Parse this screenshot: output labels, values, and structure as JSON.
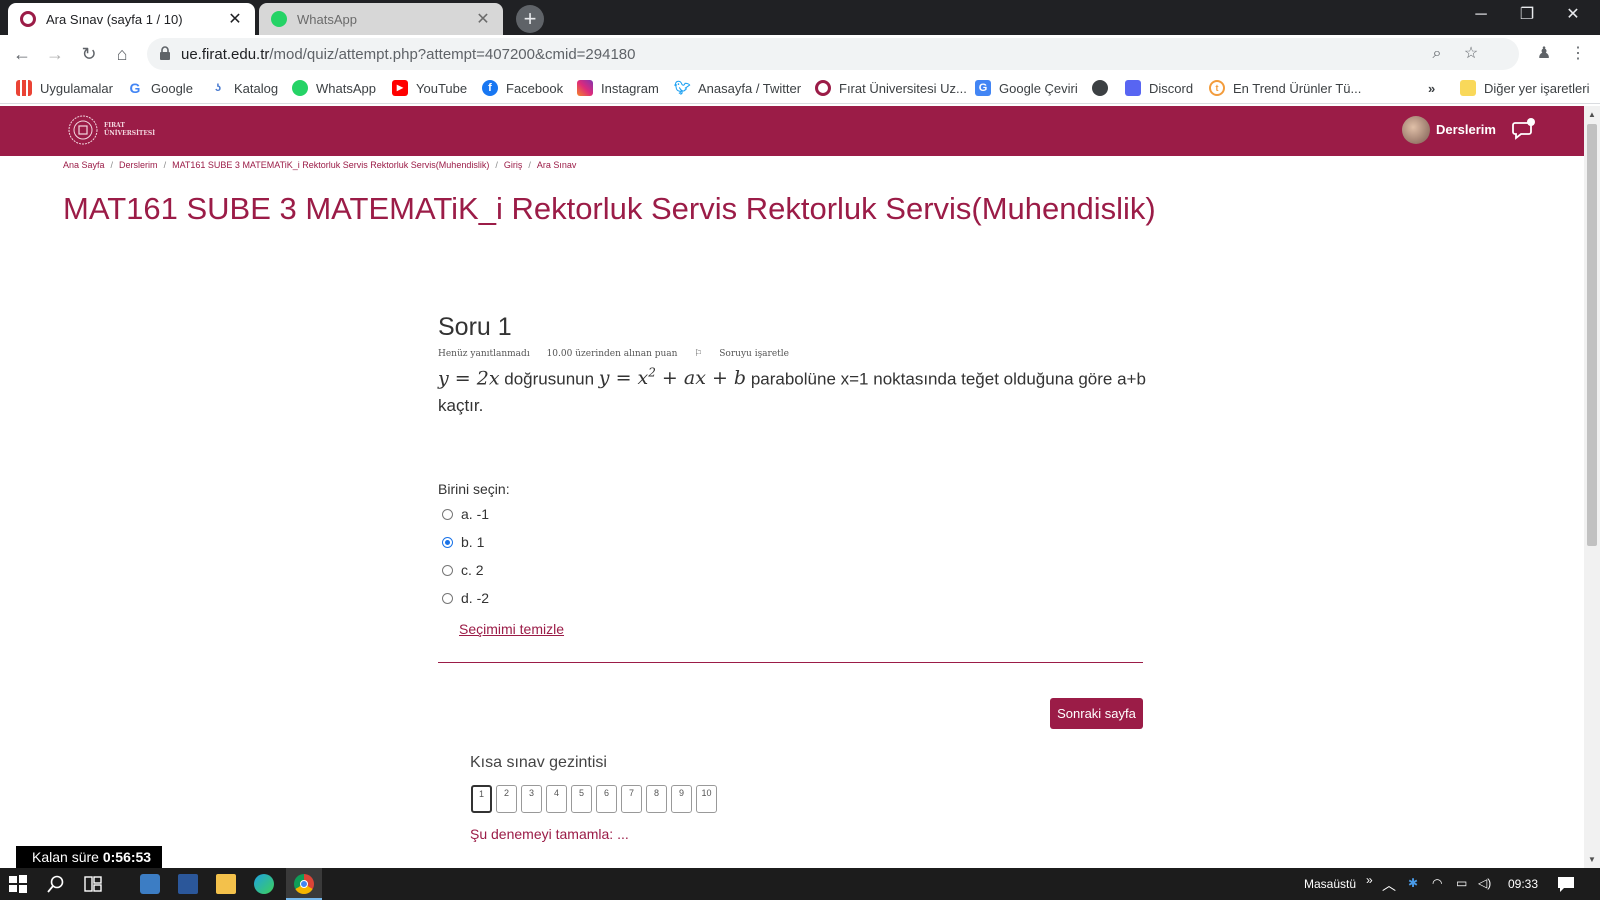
{
  "browser": {
    "tabs": [
      {
        "title": "Ara Sınav (sayfa 1 / 10)",
        "close": "✕"
      },
      {
        "title": "WhatsApp",
        "close": "✕"
      }
    ],
    "new_tab": "+",
    "window_controls": {
      "minimize": "─",
      "restore": "❐",
      "close": "✕"
    },
    "url_host": "ue.firat.edu.tr",
    "url_path": "/mod/quiz/attempt.php?attempt=407200&cmid=294180",
    "bookmarks": [
      {
        "label": "Uygulamalar",
        "icon": "apps-grid-icon"
      },
      {
        "label": "Google",
        "icon": "google-icon"
      },
      {
        "label": "Katalog",
        "icon": "katalog-icon"
      },
      {
        "label": "WhatsApp",
        "icon": "whatsapp-icon"
      },
      {
        "label": "YouTube",
        "icon": "youtube-icon"
      },
      {
        "label": "Facebook",
        "icon": "facebook-icon"
      },
      {
        "label": "Instagram",
        "icon": "instagram-icon"
      },
      {
        "label": "Anasayfa / Twitter",
        "icon": "twitter-icon"
      },
      {
        "label": "Fırat Üniversitesi Uz...",
        "icon": "firat-icon"
      },
      {
        "label": "Google Çeviri",
        "icon": "translate-icon"
      },
      {
        "label": "",
        "icon": "globe-icon"
      },
      {
        "label": "Discord",
        "icon": "discord-icon"
      },
      {
        "label": "En Trend Ürünler Tü...",
        "icon": "trend-icon"
      }
    ],
    "bookmarks_more": "»",
    "other_bookmarks": "Diğer yer işaretleri"
  },
  "site": {
    "logo_text_1": "FIRAT",
    "logo_text_2": "ÜNİVERSİTESİ",
    "user_menu": "Derslerim"
  },
  "breadcrumb": [
    "Ana Sayfa",
    "Derslerim",
    "MAT161 SUBE 3 MATEMATiK_i Rektorluk Servis Rektorluk Servis(Muhendislik)",
    "Giriş",
    "Ara Sınav"
  ],
  "breadcrumb_sep": "/",
  "page_title": "MAT161 SUBE 3 MATEMATiK_i Rektorluk Servis Rektorluk Servis(Muhendislik)",
  "question": {
    "heading": "Soru 1",
    "status": "Henüz yanıtlanmadı",
    "points": "10.00 üzerinden alınan puan",
    "flag": "Soruyu işaretle",
    "math_1": "y = 2x",
    "text_1": " doğrusunun ",
    "math_2_pre": "y = x",
    "math_2_sup": "2",
    "math_2_post": " + ax + b",
    "text_2": " parabolüne x=1 noktasında teğet olduğuna göre a+b kaçtır.",
    "prompt": "Birini seçin:",
    "options": [
      {
        "label": "a. -1",
        "checked": false
      },
      {
        "label": "b. 1",
        "checked": true
      },
      {
        "label": "c. 2",
        "checked": false
      },
      {
        "label": "d. -2",
        "checked": false
      }
    ],
    "clear_choice": "Seçimimi temizle"
  },
  "next_page": "Sonraki sayfa",
  "quiz_nav": {
    "title": "Kısa sınav gezintisi",
    "buttons": [
      "1",
      "2",
      "3",
      "4",
      "5",
      "6",
      "7",
      "8",
      "9",
      "10"
    ],
    "current": 1,
    "finish": "Şu denemeyi tamamla: ..."
  },
  "timer": {
    "label": "Kalan süre",
    "value": "0:56:53"
  },
  "taskbar": {
    "desktop": "Masaüstü",
    "more": "»",
    "time": "09:33"
  },
  "colors": {
    "brand": "#9b1c47",
    "link": "#9b1c47",
    "radio_checked": "#1a73e8"
  }
}
